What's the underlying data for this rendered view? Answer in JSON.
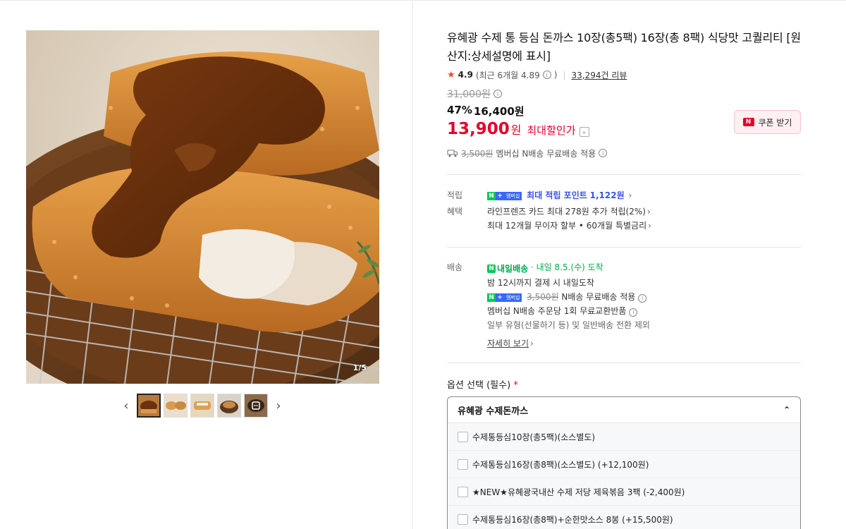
{
  "product": {
    "title": "유혜광 수제 통 등심 돈까스 10장(총5팩) 16장(총 8팩) 식당맛 고퀄리티 [원산지:상세설명에 표시]",
    "image_counter": "1/5",
    "thumb_prev": "‹",
    "thumb_next": "›"
  },
  "rating": {
    "star": "★",
    "score": "4.9",
    "recent": "(최근 6개월 4.89",
    "recent_close": ")",
    "reviews": "33,294건 리뷰"
  },
  "price": {
    "original": "31,000원",
    "discount_rate": "47%",
    "discount_price": "16,400원",
    "final_amount": "13,900",
    "final_unit": "원",
    "final_label": "최대할인가"
  },
  "coupon": {
    "label": "쿠폰 받기",
    "badge": "N"
  },
  "shipping": {
    "fee": "3,500원",
    "text": "멤버십 N배송 무료배송 적용"
  },
  "benefits": {
    "point_label": "적립",
    "point_text": "최대 적립 포인트",
    "point_value": "1,122원",
    "benefit_label": "혜택",
    "card_text": "라인프렌즈 카드 최대 278원 추가 적립(2%)",
    "installment_text": "최대 12개월 무이자 할부 • 60개월 특별금리"
  },
  "delivery": {
    "label": "배송",
    "badge_text": "내일배송",
    "arrival": "· 내일 8.5.(수) 도착",
    "cutoff": "밤 12시까지 결제 시 내일도착",
    "fee": "3,500원",
    "fee_text": "N배송 무료배송 적용",
    "exchange": "멤버십 N배송 주문당 1회 무료교환반품",
    "exception": "일부 유형(선물하기 등) 및 일반배송 전환 제외",
    "detail_link": "자세히 보기"
  },
  "options": {
    "label": "옵션 선택 (필수)",
    "required_mark": "*",
    "selected": "유혜광 수제돈까스",
    "items": [
      "수제통등심10장(총5팩)(소스별도)",
      "수제통등심16장(총8팩)(소스별도) (+12,100원)",
      "★NEW★유혜광국내산 수제 저당 제육볶음 3팩 (-2,400원)",
      "수제통등심16장(총8팩)+순한맛소스 8봉 (+15,500원)"
    ]
  },
  "badges": {
    "membership": "멤버십"
  },
  "colors": {
    "accent_red": "#e4002b",
    "naver_green": "#03c75a",
    "point_blue": "#3a52e8"
  }
}
